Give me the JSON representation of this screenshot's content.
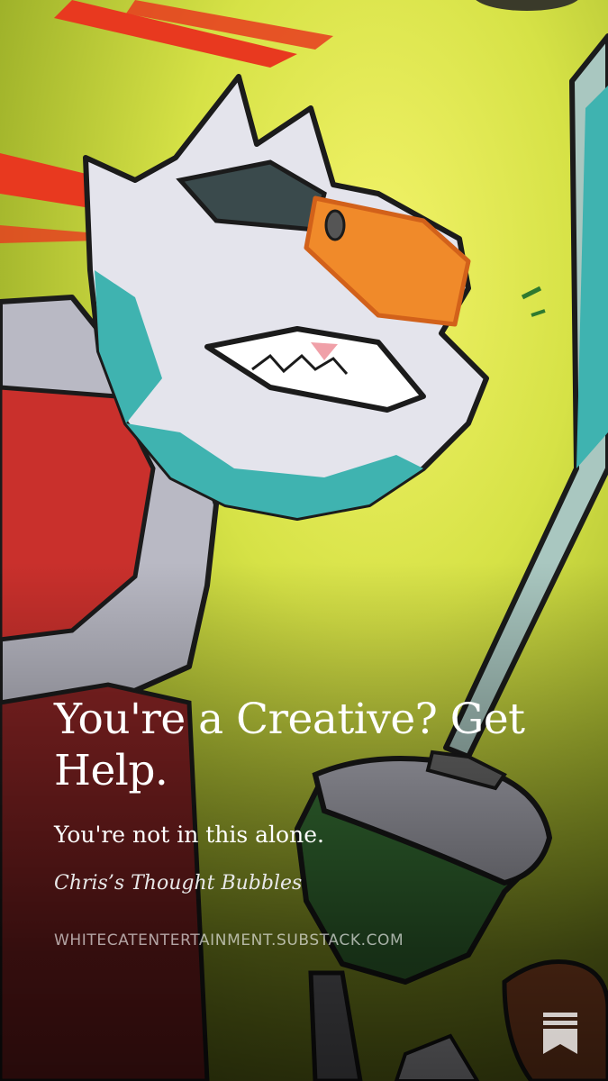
{
  "post": {
    "title": "You're a Creative? Get Help.",
    "subtitle": "You're not in this alone.",
    "publication": "Chris’s Thought Bubbles",
    "domain": "WHITECATENTERTAINMENT.SUBSTACK.COM"
  },
  "icons": {
    "logo": "substack-bookmark-icon"
  },
  "colors": {
    "background_yellow": "#e3ea4c",
    "background_olive": "#6f7f1c",
    "text": "#ffffff",
    "accent_teal": "#3fb3b0",
    "accent_orange": "#f08a2a",
    "accent_red": "#c9302c"
  }
}
